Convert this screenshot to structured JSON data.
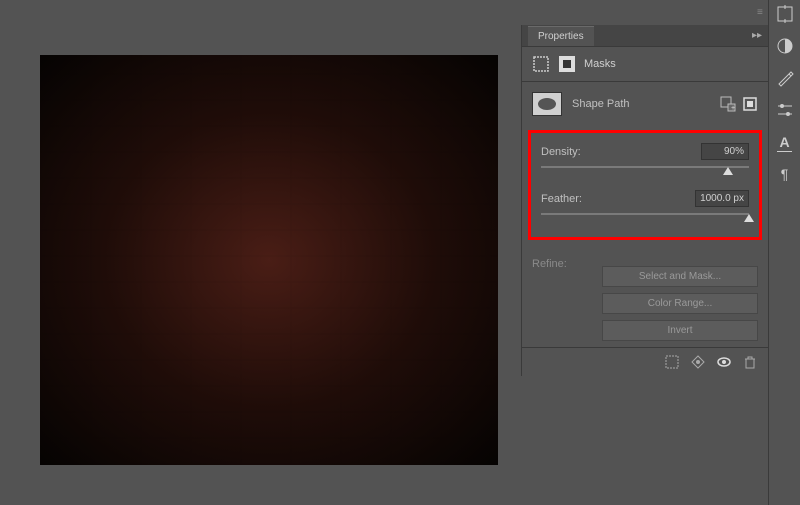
{
  "panel": {
    "title": "Properties",
    "masks_label": "Masks",
    "shape_path": "Shape Path",
    "density": {
      "label": "Density:",
      "value": "90%",
      "percent": 90
    },
    "feather": {
      "label": "Feather:",
      "value": "1000.0 px",
      "percent": 100
    },
    "refine_label": "Refine:",
    "buttons": {
      "select_mask": "Select and Mask...",
      "color_range": "Color Range...",
      "invert": "Invert"
    }
  }
}
